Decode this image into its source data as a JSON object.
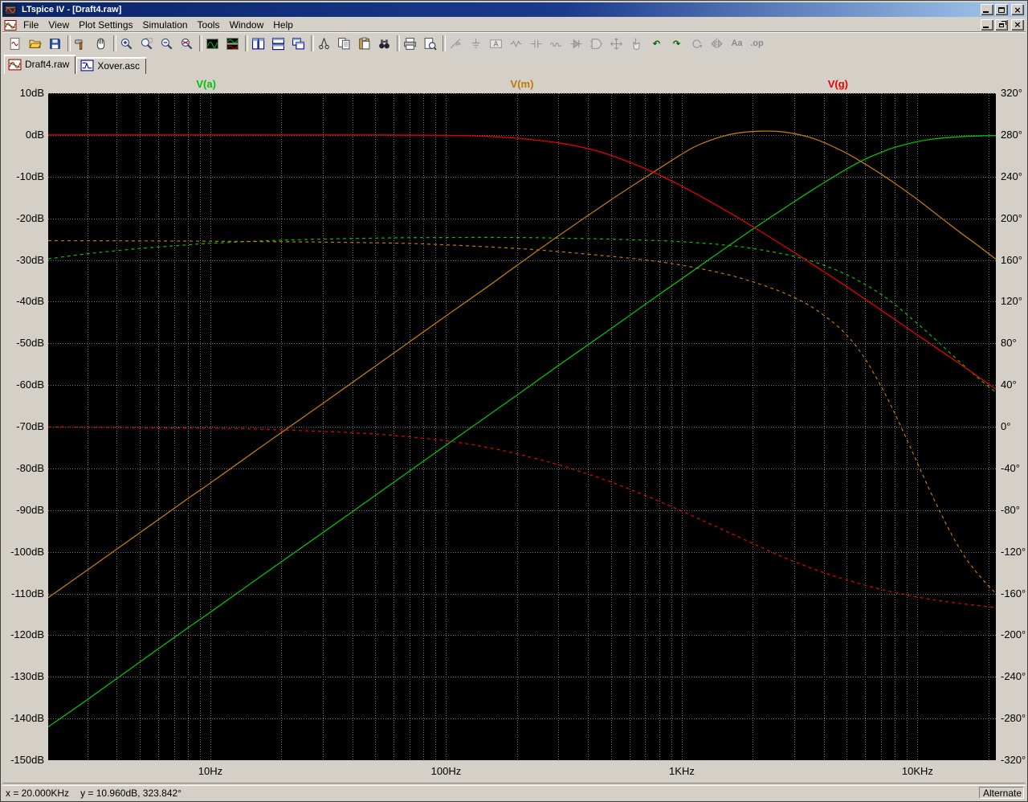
{
  "window": {
    "title": "LTspice IV - [Draft4.raw]",
    "app_buttons": [
      "minimize",
      "maximize",
      "close"
    ],
    "child_buttons": [
      "minimize",
      "restore",
      "close"
    ]
  },
  "menu": {
    "items": [
      "File",
      "View",
      "Plot Settings",
      "Simulation",
      "Tools",
      "Window",
      "Help"
    ]
  },
  "toolbar": {
    "groups": [
      [
        {
          "name": "new-schematic"
        },
        {
          "name": "open"
        },
        {
          "name": "save"
        }
      ],
      [
        {
          "name": "control-panel"
        },
        {
          "name": "halt"
        }
      ],
      [
        {
          "name": "zoom-in"
        },
        {
          "name": "zoom-box"
        },
        {
          "name": "zoom-out"
        },
        {
          "name": "zoom-full"
        }
      ],
      [
        {
          "name": "autorange"
        },
        {
          "name": "add-plot-pane"
        }
      ],
      [
        {
          "name": "tile-vertical"
        },
        {
          "name": "tile-horizontal"
        },
        {
          "name": "cascade"
        }
      ],
      [
        {
          "name": "cut"
        },
        {
          "name": "copy"
        },
        {
          "name": "paste"
        },
        {
          "name": "find"
        }
      ],
      [
        {
          "name": "print"
        },
        {
          "name": "print-preview"
        }
      ],
      [
        {
          "name": "draw-wire",
          "enabled": false
        },
        {
          "name": "ground",
          "enabled": false
        },
        {
          "name": "net-label",
          "enabled": false
        },
        {
          "name": "resistor",
          "enabled": false
        },
        {
          "name": "capacitor",
          "enabled": false
        },
        {
          "name": "inductor",
          "enabled": false
        },
        {
          "name": "diode",
          "enabled": false
        },
        {
          "name": "component",
          "enabled": false
        },
        {
          "name": "move",
          "enabled": false
        },
        {
          "name": "drag",
          "enabled": false
        },
        {
          "name": "undo"
        },
        {
          "name": "redo"
        },
        {
          "name": "rotate",
          "enabled": false
        },
        {
          "name": "mirror",
          "enabled": false
        },
        {
          "name": "text",
          "enabled": false,
          "glyph": "Aa"
        },
        {
          "name": "spice-directive",
          "enabled": false,
          "glyph": ".op"
        }
      ]
    ]
  },
  "tabs": [
    {
      "label": "Draft4.raw",
      "icon": "waveform-doc",
      "active": true
    },
    {
      "label": "Xover.asc",
      "icon": "schematic-doc",
      "active": false
    }
  ],
  "status": {
    "x_readout": "x = 20.000KHz",
    "y_readout": "y = 10.960dB, 323.842°",
    "mode": "Alternate"
  },
  "chart_data": {
    "type": "line",
    "background": "#000000",
    "grid": true,
    "grid_color": "#787878",
    "x_axis": {
      "scale": "log",
      "unit": "Hz",
      "min": 2.05,
      "max": 21500,
      "ticks": [
        {
          "f": 10,
          "label": "10Hz"
        },
        {
          "f": 100,
          "label": "100Hz"
        },
        {
          "f": 1000,
          "label": "1KHz"
        },
        {
          "f": 10000,
          "label": "10KHz"
        }
      ]
    },
    "y_left": {
      "unit": "dB",
      "min": -150,
      "max": 10,
      "step": 10,
      "labels": [
        "10dB",
        "0dB",
        "-10dB",
        "-20dB",
        "-30dB",
        "-40dB",
        "-50dB",
        "-60dB",
        "-70dB",
        "-80dB",
        "-90dB",
        "-100dB",
        "-110dB",
        "-120dB",
        "-130dB",
        "-140dB",
        "-150dB"
      ]
    },
    "y_right": {
      "unit": "deg",
      "min": -320,
      "max": 320,
      "step": 40,
      "labels": [
        "320°",
        "280°",
        "240°",
        "200°",
        "160°",
        "120°",
        "80°",
        "40°",
        "0°",
        "-40°",
        "-80°",
        "-120°",
        "-160°",
        "-200°",
        "-240°",
        "-280°",
        "-320°"
      ]
    },
    "traces": [
      {
        "name": "V(a)",
        "color": "#00c000",
        "magnitude_db": [
          [
            2.05,
            -142
          ],
          [
            3,
            -135.5
          ],
          [
            5,
            -126.5
          ],
          [
            8,
            -118.3
          ],
          [
            10,
            -114.5
          ],
          [
            15,
            -107.4
          ],
          [
            20,
            -102.4
          ],
          [
            30,
            -95.4
          ],
          [
            50,
            -86.5
          ],
          [
            80,
            -78.3
          ],
          [
            100,
            -74.4
          ],
          [
            150,
            -67.4
          ],
          [
            200,
            -62.4
          ],
          [
            300,
            -55.3
          ],
          [
            500,
            -46.5
          ],
          [
            800,
            -38.3
          ],
          [
            1000,
            -34.5
          ],
          [
            1500,
            -27.5
          ],
          [
            2000,
            -22.6
          ],
          [
            3000,
            -16
          ],
          [
            4000,
            -11.5
          ],
          [
            5000,
            -8.2
          ],
          [
            6000,
            -5.8
          ],
          [
            7000,
            -4.2
          ],
          [
            8000,
            -3.0
          ],
          [
            10000,
            -1.6
          ],
          [
            12000,
            -0.9
          ],
          [
            15000,
            -0.45
          ],
          [
            18000,
            -0.25
          ],
          [
            21500,
            -0.15
          ]
        ],
        "phase_deg": [
          [
            2.05,
            161
          ],
          [
            3,
            166
          ],
          [
            5,
            171
          ],
          [
            8,
            174.5
          ],
          [
            10,
            176
          ],
          [
            20,
            179
          ],
          [
            50,
            181
          ],
          [
            100,
            181.5
          ],
          [
            200,
            181.5
          ],
          [
            300,
            181
          ],
          [
            500,
            180
          ],
          [
            700,
            179
          ],
          [
            1000,
            177.5
          ],
          [
            1500,
            174.5
          ],
          [
            2000,
            171
          ],
          [
            3000,
            163.5
          ],
          [
            4000,
            155
          ],
          [
            5000,
            146
          ],
          [
            6000,
            136.5
          ],
          [
            7000,
            127
          ],
          [
            8000,
            117.5
          ],
          [
            10000,
            99
          ],
          [
            12000,
            83
          ],
          [
            15000,
            63
          ],
          [
            18000,
            47
          ],
          [
            21500,
            33
          ]
        ]
      },
      {
        "name": "V(m)",
        "color": "#c07800",
        "magnitude_db": [
          [
            2.05,
            -111
          ],
          [
            3,
            -104.4
          ],
          [
            5,
            -95.5
          ],
          [
            8,
            -87.3
          ],
          [
            10,
            -83.5
          ],
          [
            15,
            -76.4
          ],
          [
            20,
            -71.4
          ],
          [
            30,
            -64.4
          ],
          [
            50,
            -55.5
          ],
          [
            80,
            -47.3
          ],
          [
            100,
            -43.4
          ],
          [
            150,
            -36.4
          ],
          [
            200,
            -31.3
          ],
          [
            300,
            -24.2
          ],
          [
            500,
            -15.6
          ],
          [
            700,
            -10.2
          ],
          [
            1000,
            -4.6
          ],
          [
            1200,
            -2.2
          ],
          [
            1500,
            -0.3
          ],
          [
            1800,
            0.6
          ],
          [
            2200,
            0.9
          ],
          [
            2600,
            0.8
          ],
          [
            3000,
            0.3
          ],
          [
            3500,
            -0.6
          ],
          [
            4000,
            -1.8
          ],
          [
            5000,
            -4.4
          ],
          [
            6000,
            -7.0
          ],
          [
            7000,
            -9.4
          ],
          [
            8000,
            -11.6
          ],
          [
            10000,
            -15.5
          ],
          [
            12000,
            -19
          ],
          [
            15000,
            -23.2
          ],
          [
            18000,
            -26.5
          ],
          [
            21500,
            -29.8
          ]
        ],
        "phase_deg": [
          [
            2.05,
            178.5
          ],
          [
            10,
            178
          ],
          [
            50,
            176.5
          ],
          [
            100,
            174.5
          ],
          [
            200,
            171
          ],
          [
            300,
            168
          ],
          [
            500,
            163.5
          ],
          [
            700,
            160
          ],
          [
            1000,
            155
          ],
          [
            1500,
            147
          ],
          [
            2000,
            139
          ],
          [
            2500,
            131.5
          ],
          [
            3000,
            124
          ],
          [
            3500,
            116
          ],
          [
            4000,
            107
          ],
          [
            4500,
            98
          ],
          [
            5000,
            88
          ],
          [
            5500,
            77
          ],
          [
            6000,
            65
          ],
          [
            6500,
            52
          ],
          [
            7000,
            39
          ],
          [
            7500,
            26
          ],
          [
            8000,
            13
          ],
          [
            9000,
            -12
          ],
          [
            10000,
            -35
          ],
          [
            11000,
            -56
          ],
          [
            12000,
            -74
          ],
          [
            13000,
            -90
          ],
          [
            14000,
            -104
          ],
          [
            15000,
            -116
          ],
          [
            16000,
            -126
          ],
          [
            17000,
            -134
          ],
          [
            18000,
            -141
          ],
          [
            19500,
            -150
          ],
          [
            21500,
            -160
          ]
        ]
      },
      {
        "name": "V(g)",
        "color": "#e80000",
        "magnitude_db": [
          [
            2.05,
            0
          ],
          [
            10,
            0
          ],
          [
            50,
            0
          ],
          [
            100,
            -0.1
          ],
          [
            150,
            -0.35
          ],
          [
            200,
            -0.8
          ],
          [
            300,
            -1.9
          ],
          [
            400,
            -3.3
          ],
          [
            500,
            -4.9
          ],
          [
            700,
            -8.1
          ],
          [
            1000,
            -12.3
          ],
          [
            1500,
            -17.8
          ],
          [
            2000,
            -22
          ],
          [
            3000,
            -28.2
          ],
          [
            4000,
            -32.8
          ],
          [
            5000,
            -36.4
          ],
          [
            7000,
            -42
          ],
          [
            10000,
            -48
          ],
          [
            15000,
            -54.8
          ],
          [
            21500,
            -61
          ]
        ],
        "phase_deg": [
          [
            2.05,
            -0.3
          ],
          [
            10,
            -1.5
          ],
          [
            20,
            -3
          ],
          [
            50,
            -7
          ],
          [
            100,
            -13.5
          ],
          [
            150,
            -20
          ],
          [
            200,
            -26
          ],
          [
            300,
            -36.5
          ],
          [
            400,
            -45.5
          ],
          [
            500,
            -53
          ],
          [
            700,
            -66
          ],
          [
            1000,
            -81
          ],
          [
            1500,
            -99
          ],
          [
            2000,
            -112
          ],
          [
            2500,
            -122
          ],
          [
            3000,
            -129.5
          ],
          [
            4000,
            -140
          ],
          [
            5000,
            -147
          ],
          [
            7000,
            -156
          ],
          [
            10000,
            -163.5
          ],
          [
            15000,
            -169.5
          ],
          [
            21500,
            -173.5
          ]
        ]
      }
    ],
    "style_note": "solid = magnitude (left dB axis), dashed = phase (right degree axis)"
  }
}
